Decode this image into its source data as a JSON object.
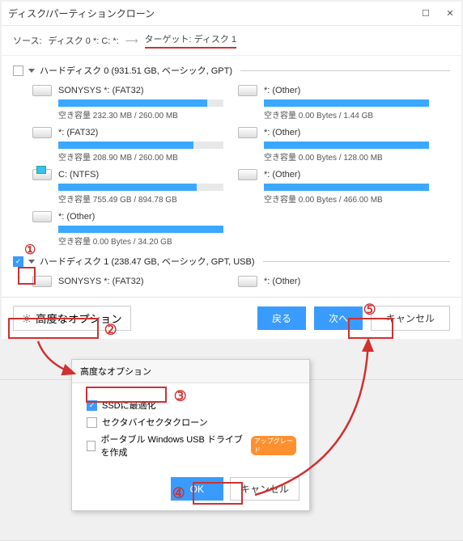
{
  "window": {
    "title": "ディスク/パーティションクローン"
  },
  "breadcrumb": {
    "source_label": "ソース:",
    "source_value": "ディスク 0 *: C: *:",
    "target_label": "ターゲット:",
    "target_value": "ディスク 1"
  },
  "disk0": {
    "header": "ハードディスク 0 (931.51 GB, ベーシック, GPT)",
    "parts": [
      {
        "name": "SONYSYS *: (FAT32)",
        "fill": 90,
        "info": "空き容量 232.30 MB / 260.00 MB"
      },
      {
        "name": "*: (Other)",
        "fill": 100,
        "info": "空き容量 0.00 Bytes / 1.44 GB"
      },
      {
        "name": "*: (FAT32)",
        "fill": 82,
        "info": "空き容量 208.90 MB / 260.00 MB"
      },
      {
        "name": "*: (Other)",
        "fill": 100,
        "info": "空き容量 0.00 Bytes / 128.00 MB"
      },
      {
        "name": "C: (NTFS)",
        "fill": 84,
        "info": "空き容量 755.49 GB / 894.78 GB",
        "win": true
      },
      {
        "name": "*: (Other)",
        "fill": 100,
        "info": "空き容量 0.00 Bytes / 466.00 MB"
      },
      {
        "name": "*: (Other)",
        "fill": 100,
        "info": "空き容量 0.00 Bytes / 34.20 GB"
      }
    ]
  },
  "disk1": {
    "header": "ハードディスク 1 (238.47 GB, ベーシック, GPT, USB)",
    "parts": [
      {
        "name": "SONYSYS *: (FAT32)"
      },
      {
        "name": "*: (Other)"
      }
    ]
  },
  "buttons": {
    "advanced": "高度なオプション",
    "back": "戻る",
    "next": "次へ",
    "cancel": "キャンセル"
  },
  "dialog": {
    "title": "高度なオプション",
    "opt_ssd": "SSDに最適化",
    "opt_sector": "セクタバイセクタクローン",
    "opt_usb": "ポータブル Windows USB ドライブを作成",
    "tag": "アップグレード",
    "ok": "OK",
    "cancel": "キャンセル"
  },
  "annotations": {
    "a1": "①",
    "a2": "➁",
    "a3": "➂",
    "a4": "➃",
    "a5": "➄"
  }
}
